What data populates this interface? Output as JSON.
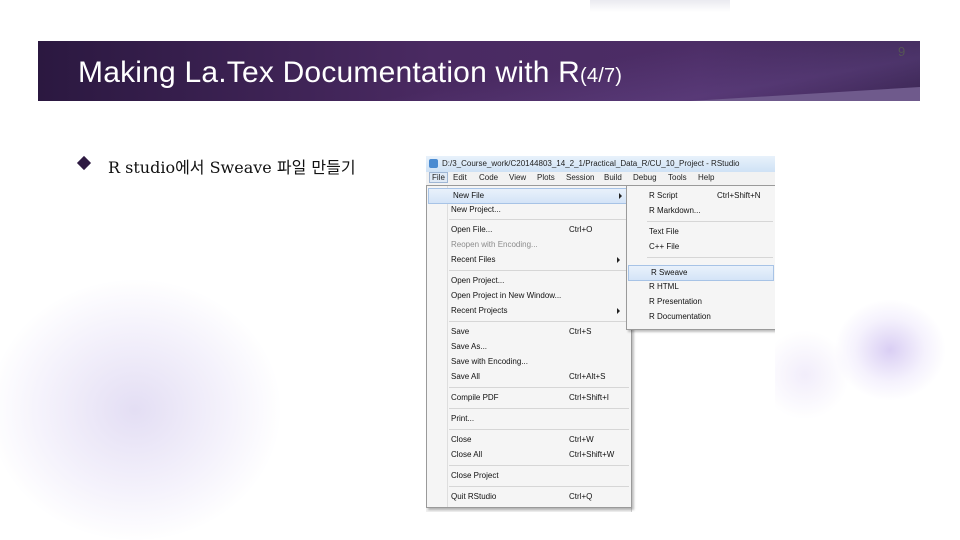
{
  "slide": {
    "title": "Making La.Tex Documentation with R",
    "title_suffix": "(4/7)",
    "number": "9",
    "bullet": "R studio에서 Sweave 파일 만들기"
  },
  "colors": {
    "banner": "#4a2a62",
    "bullet": "#2e1a42",
    "highlight": "#d4e4f7"
  },
  "rstudio": {
    "window_title": "D:/3_Course_work/C20144803_14_2_1/Practical_Data_R/CU_10_Project - RStudio",
    "menubar": [
      "File",
      "Edit",
      "Code",
      "View",
      "Plots",
      "Session",
      "Build",
      "Debug",
      "Tools",
      "Help"
    ],
    "file_menu": {
      "new_file": "New File",
      "new_project": "New Project...",
      "open_file": "Open File...",
      "open_file_sc": "Ctrl+O",
      "reopen_encoding": "Reopen with Encoding...",
      "recent_files": "Recent Files",
      "open_project": "Open Project...",
      "open_project_new_window": "Open Project in New Window...",
      "recent_projects": "Recent Projects",
      "save": "Save",
      "save_sc": "Ctrl+S",
      "save_as": "Save As...",
      "save_encoding": "Save with Encoding...",
      "save_all": "Save All",
      "save_all_sc": "Ctrl+Alt+S",
      "compile_pdf": "Compile PDF",
      "compile_pdf_sc": "Ctrl+Shift+I",
      "print": "Print...",
      "close": "Close",
      "close_sc": "Ctrl+W",
      "close_all": "Close All",
      "close_all_sc": "Ctrl+Shift+W",
      "close_project": "Close Project",
      "quit": "Quit RStudio",
      "quit_sc": "Ctrl+Q"
    },
    "new_file_submenu": {
      "r_script": "R Script",
      "r_script_sc": "Ctrl+Shift+N",
      "r_markdown": "R Markdown...",
      "text_file": "Text File",
      "cpp_file": "C++ File",
      "r_sweave": "R Sweave",
      "r_html": "R HTML",
      "r_presentation": "R Presentation",
      "r_documentation": "R Documentation"
    }
  }
}
